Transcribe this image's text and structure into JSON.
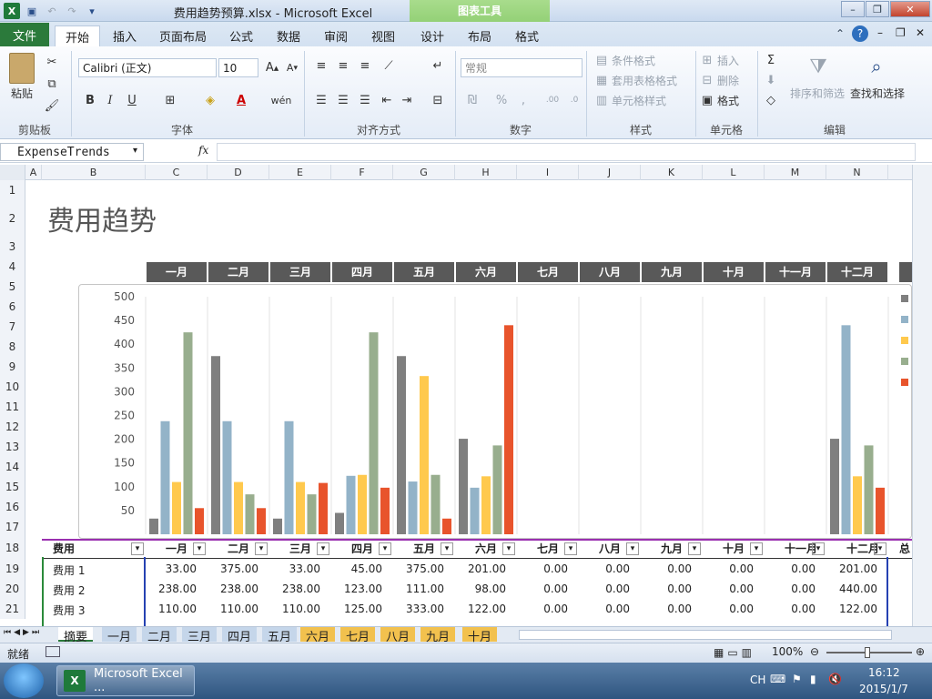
{
  "titlebar": {
    "doc_title": "费用趋势预算.xlsx - Microsoft Excel",
    "chart_tools": "图表工具"
  },
  "ribbon_tabs": [
    "文件",
    "开始",
    "插入",
    "页面布局",
    "公式",
    "数据",
    "审阅",
    "视图",
    "设计",
    "布局",
    "格式"
  ],
  "ribbon": {
    "paste": "粘贴",
    "font_name": "Calibri (正文)",
    "font_size": "10",
    "number_format": "常规",
    "cond_format": "条件格式",
    "table_format": "套用表格格式",
    "cell_styles": "单元格样式",
    "insert": "插入",
    "delete": "删除",
    "format": "格式",
    "sort_filter": "排序和筛选",
    "find_select": "查找和选择",
    "groups": {
      "clipboard": "剪贴板",
      "font": "字体",
      "alignment": "对齐方式",
      "number": "数字",
      "styles": "样式",
      "cells": "单元格",
      "editing": "编辑"
    }
  },
  "namebox": "ExpenseTrends",
  "fx": "fx",
  "columns": [
    "A",
    "B",
    "C",
    "D",
    "E",
    "F",
    "G",
    "H",
    "I",
    "J",
    "K",
    "L",
    "M",
    "N"
  ],
  "rows": [
    "1",
    "2",
    "3",
    "4",
    "5",
    "6",
    "7",
    "8",
    "9",
    "10",
    "11",
    "12",
    "13",
    "14",
    "15",
    "16",
    "17",
    "18",
    "19",
    "20",
    "21"
  ],
  "sheet_title": "费用趋势",
  "months": [
    "一月",
    "二月",
    "三月",
    "四月",
    "五月",
    "六月",
    "七月",
    "八月",
    "九月",
    "十月",
    "十一月",
    "十二月"
  ],
  "chart_data": {
    "type": "bar",
    "categories": [
      "一月",
      "二月",
      "三月",
      "四月",
      "五月",
      "六月",
      "七月",
      "八月",
      "九月",
      "十月",
      "十一月",
      "十二月"
    ],
    "ylim": [
      0,
      500
    ],
    "yticks": [
      50,
      100,
      150,
      200,
      250,
      300,
      350,
      400,
      450,
      500
    ],
    "series": [
      {
        "color": "#7f7f7f",
        "values": [
          33,
          375,
          33,
          45,
          375,
          201,
          0,
          0,
          0,
          0,
          0,
          201
        ]
      },
      {
        "color": "#93b3c8",
        "values": [
          238,
          238,
          238,
          123,
          111,
          98,
          0,
          0,
          0,
          0,
          0,
          440
        ]
      },
      {
        "color": "#ffc94d",
        "values": [
          110,
          110,
          110,
          125,
          333,
          122,
          0,
          0,
          0,
          0,
          0,
          122
        ]
      },
      {
        "color": "#98ae8e",
        "values": [
          425,
          84,
          84,
          425,
          125,
          187,
          0,
          0,
          0,
          0,
          0,
          187
        ]
      },
      {
        "color": "#e8542c",
        "values": [
          55,
          55,
          108,
          98,
          33,
          440,
          0,
          0,
          0,
          0,
          0,
          98
        ]
      }
    ]
  },
  "table": {
    "header_first": "费用",
    "header_months": [
      "一月",
      "二月",
      "三月",
      "四月",
      "五月",
      "六月",
      "七月",
      "八月",
      "九月",
      "十月",
      "十一月",
      "十二月"
    ],
    "header_last": "总计",
    "rows": [
      {
        "label": "费用 1",
        "values": [
          "33.00",
          "375.00",
          "33.00",
          "45.00",
          "375.00",
          "201.00",
          "0.00",
          "0.00",
          "0.00",
          "0.00",
          "0.00",
          "201.00"
        ]
      },
      {
        "label": "费用 2",
        "values": [
          "238.00",
          "238.00",
          "238.00",
          "123.00",
          "111.00",
          "98.00",
          "0.00",
          "0.00",
          "0.00",
          "0.00",
          "0.00",
          "440.00"
        ]
      },
      {
        "label": "费用 3",
        "values": [
          "110.00",
          "110.00",
          "110.00",
          "125.00",
          "333.00",
          "122.00",
          "0.00",
          "0.00",
          "0.00",
          "0.00",
          "0.00",
          "122.00"
        ]
      }
    ]
  },
  "sheet_tabs": [
    "摘要",
    "一月",
    "二月",
    "三月",
    "四月",
    "五月",
    "六月",
    "七月",
    "八月",
    "九月",
    "十月"
  ],
  "status": {
    "ready": "就绪",
    "zoom": "100%"
  },
  "taskbar": {
    "app": "Microsoft Excel ...",
    "lang": "CH",
    "time": "16:12",
    "date": "2015/1/7"
  }
}
